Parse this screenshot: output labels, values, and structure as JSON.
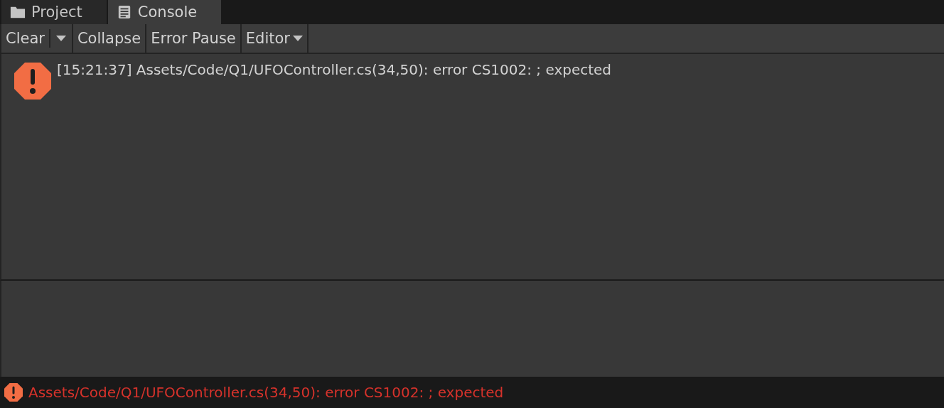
{
  "tabs": [
    {
      "label": "Project",
      "kind": "project",
      "selected": false
    },
    {
      "label": "Console",
      "kind": "console",
      "selected": true
    }
  ],
  "toolbar": [
    {
      "label": "Clear",
      "kind": "split"
    },
    {
      "label": "Collapse",
      "kind": "button"
    },
    {
      "label": "Error Pause",
      "kind": "button"
    },
    {
      "label": "Editor",
      "kind": "dropdown"
    }
  ],
  "log_entries": [
    {
      "kind": "error",
      "message": "[15:21:37] Assets/Code/Q1/UFOController.cs(34,50): error CS1002: ; expected"
    }
  ],
  "status_bar": {
    "kind": "error",
    "message": "Assets/Code/Q1/UFOController.cs(34,50): error CS1002: ; expected"
  }
}
